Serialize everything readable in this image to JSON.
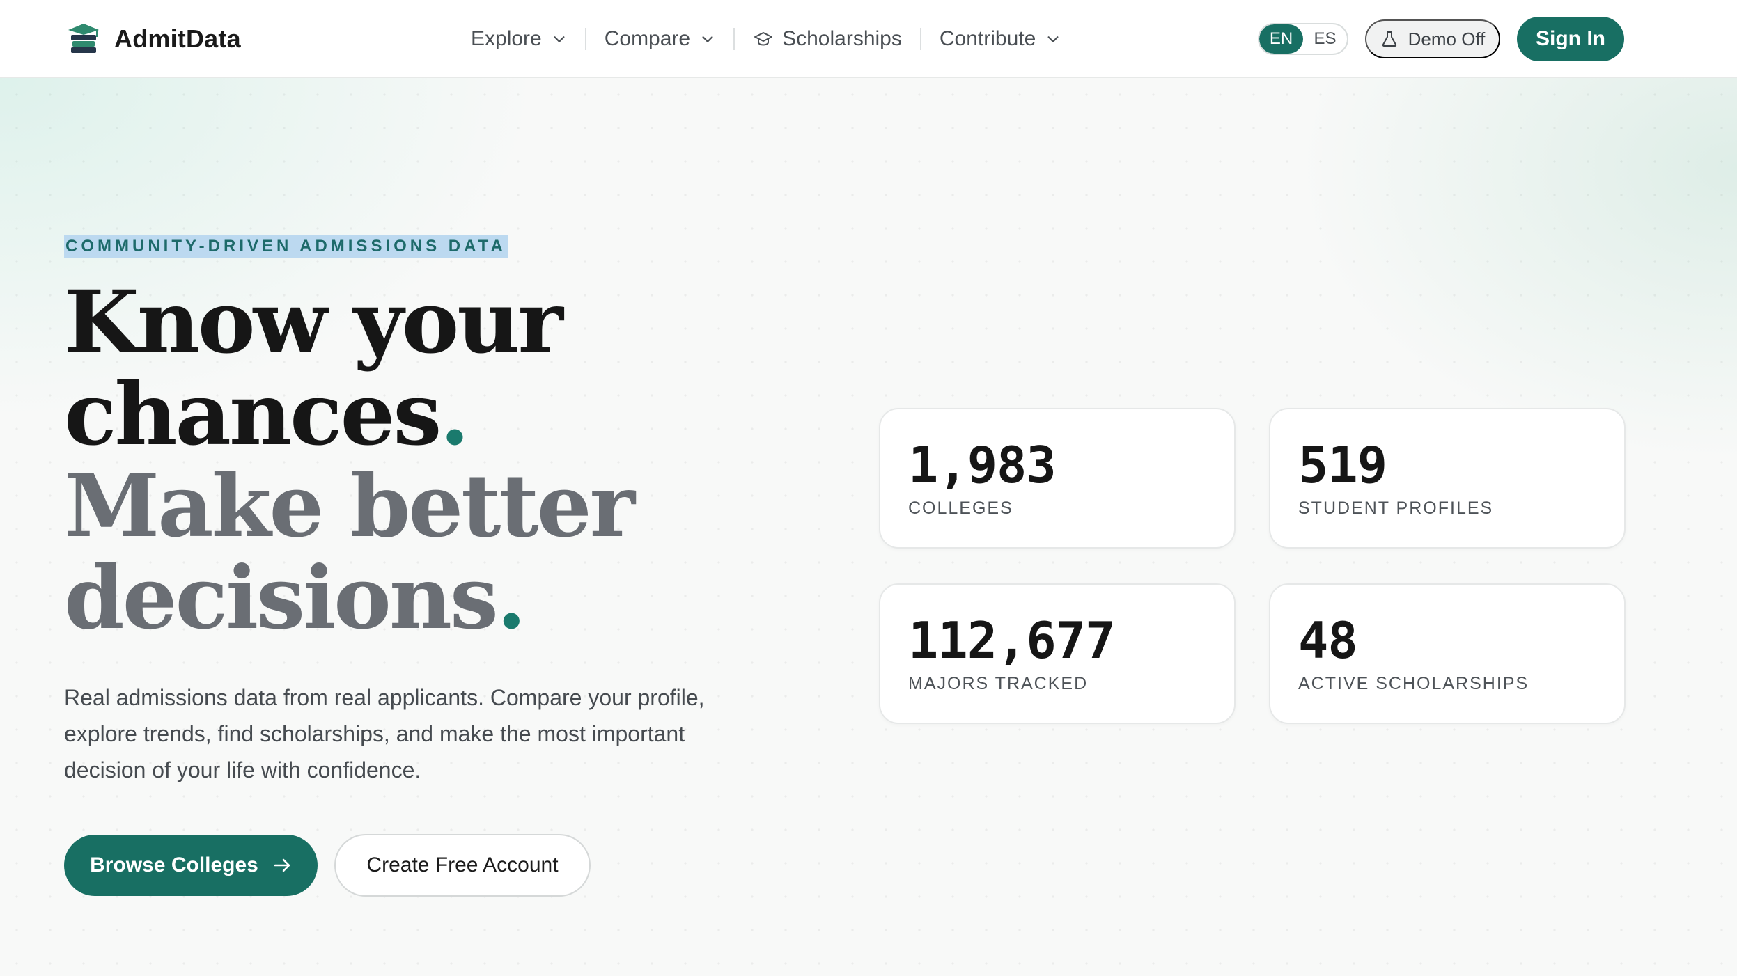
{
  "brand": {
    "name": "AdmitData",
    "logo_icon": "graduation-cap-stack-icon"
  },
  "nav": {
    "items": [
      {
        "label": "Explore",
        "has_dropdown": true
      },
      {
        "label": "Compare",
        "has_dropdown": true
      },
      {
        "label": "Scholarships",
        "icon": "graduation-cap-icon",
        "has_dropdown": false
      },
      {
        "label": "Contribute",
        "has_dropdown": true
      }
    ],
    "language": {
      "options": [
        "EN",
        "ES"
      ],
      "selected": "EN"
    },
    "demo_label": "Demo Off",
    "sign_in_label": "Sign In"
  },
  "hero": {
    "eyebrow": "COMMUNITY-DRIVEN ADMISSIONS DATA",
    "headline_line1": "Know your",
    "headline_line2": "chances",
    "headline_line3": "Make better",
    "headline_line4": "decisions",
    "headline_dot": ".",
    "lead": "Real admissions data from real applicants. Compare your profile, explore trends, find scholarships, and make the most important decision of your life with confidence.",
    "primary_cta": "Browse Colleges",
    "secondary_cta": "Create Free Account"
  },
  "stats": [
    {
      "value": "1,983",
      "label": "COLLEGES"
    },
    {
      "value": "519",
      "label": "STUDENT PROFILES"
    },
    {
      "value": "112,677",
      "label": "MAJORS TRACKED"
    },
    {
      "value": "48",
      "label": "ACTIVE SCHOLARSHIPS"
    }
  ],
  "colors": {
    "accent": "#186f63",
    "eyebrow_highlight": "#bcd9f0",
    "muted_text": "#6a6e74"
  }
}
